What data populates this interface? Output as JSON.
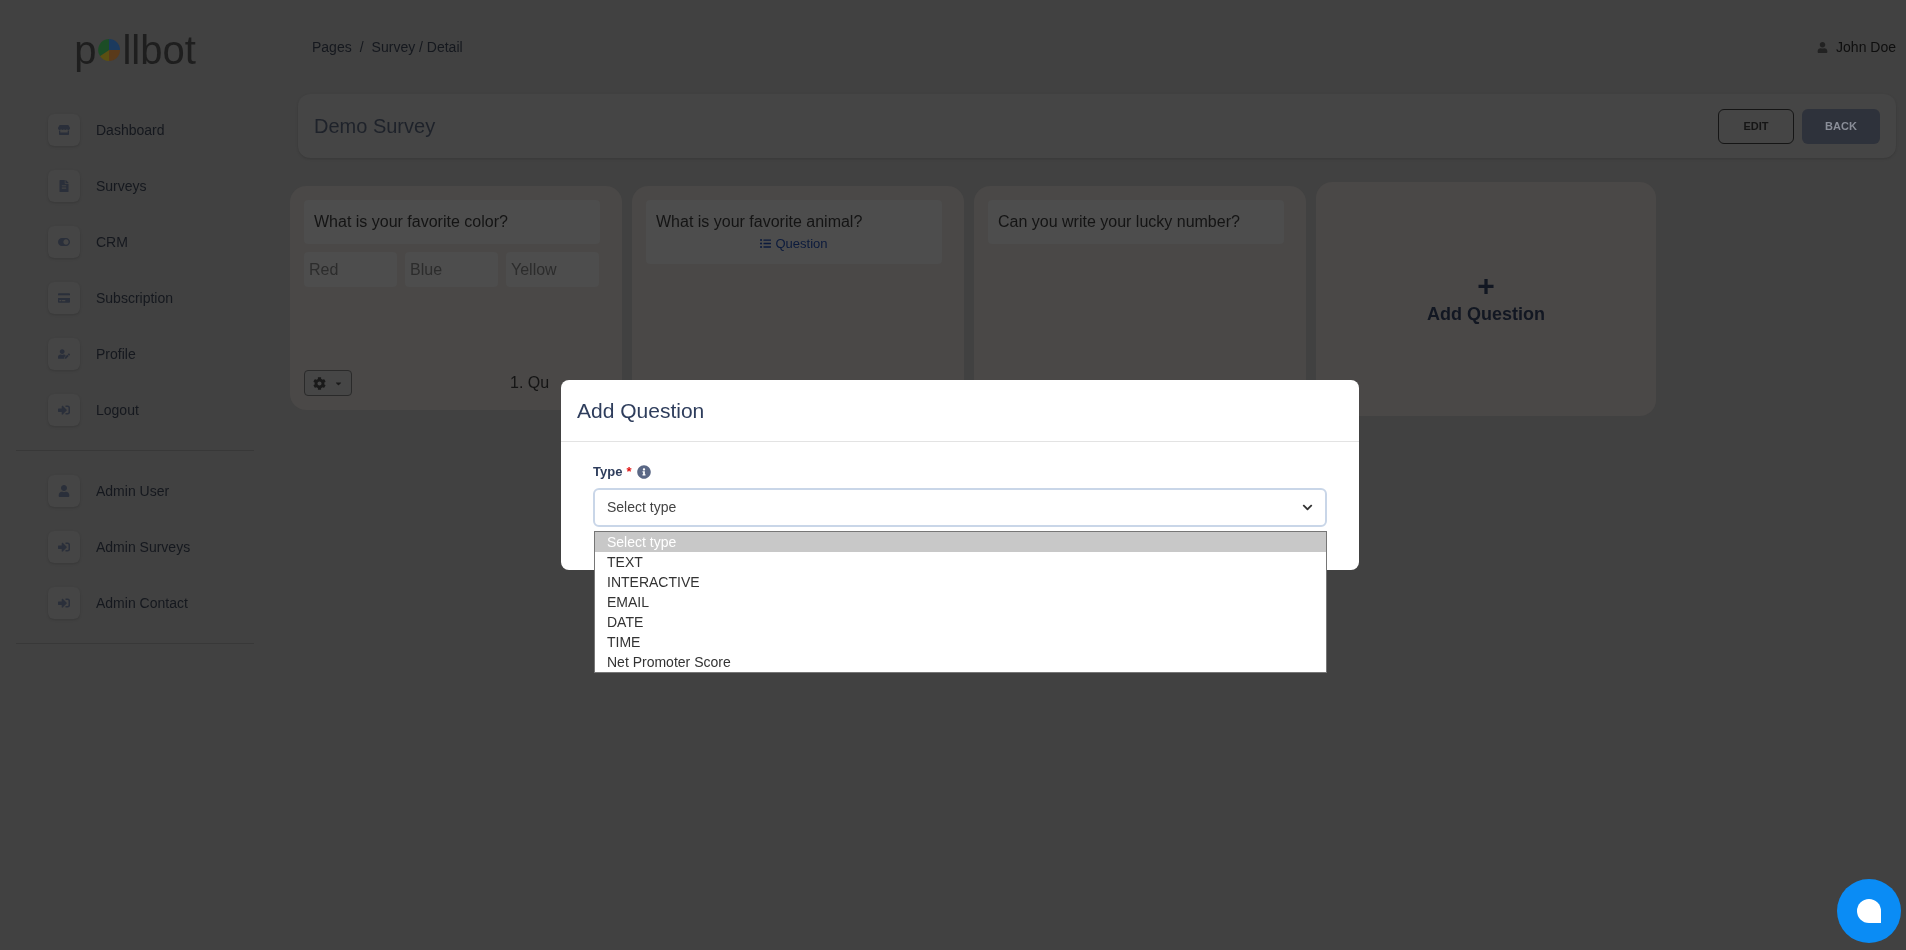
{
  "logo": {
    "before": "p",
    "after": "llbot"
  },
  "sidebar": {
    "items": [
      {
        "label": "Dashboard"
      },
      {
        "label": "Surveys"
      },
      {
        "label": "CRM"
      },
      {
        "label": "Subscription"
      },
      {
        "label": "Profile"
      },
      {
        "label": "Logout"
      }
    ],
    "admin_items": [
      {
        "label": "Admin User"
      },
      {
        "label": "Admin Surveys"
      },
      {
        "label": "Admin Contact"
      }
    ]
  },
  "breadcrumb": {
    "items": [
      "Pages",
      "Survey / Detail"
    ],
    "separator": "/"
  },
  "user": "John Doe",
  "header": {
    "title": "Demo Survey",
    "buttons": [
      {
        "label": "EDIT",
        "kind": "outline"
      },
      {
        "label": "BACK",
        "kind": "solid"
      }
    ]
  },
  "cards": [
    {
      "question": "What is your favorite color?",
      "options": [
        "Red",
        "Blue",
        "Yellow"
      ],
      "footer": "1. Qu"
    },
    {
      "question": "What is your favorite animal?",
      "link": "Question"
    },
    {
      "question": "Can you write your lucky number?"
    }
  ],
  "add_card": {
    "symbol": "+",
    "label": "Add Question"
  },
  "modal": {
    "title": "Add Question",
    "field": {
      "label": "Type",
      "required_mark": "*",
      "value": "Select type"
    },
    "options": [
      {
        "label": "Select type",
        "selected": true
      },
      {
        "label": "TEXT",
        "selected": false
      },
      {
        "label": "INTERACTIVE",
        "selected": false
      },
      {
        "label": "EMAIL",
        "selected": false
      },
      {
        "label": "DATE",
        "selected": false
      },
      {
        "label": "TIME",
        "selected": false
      },
      {
        "label": "Net Promoter Score",
        "selected": false
      }
    ]
  }
}
